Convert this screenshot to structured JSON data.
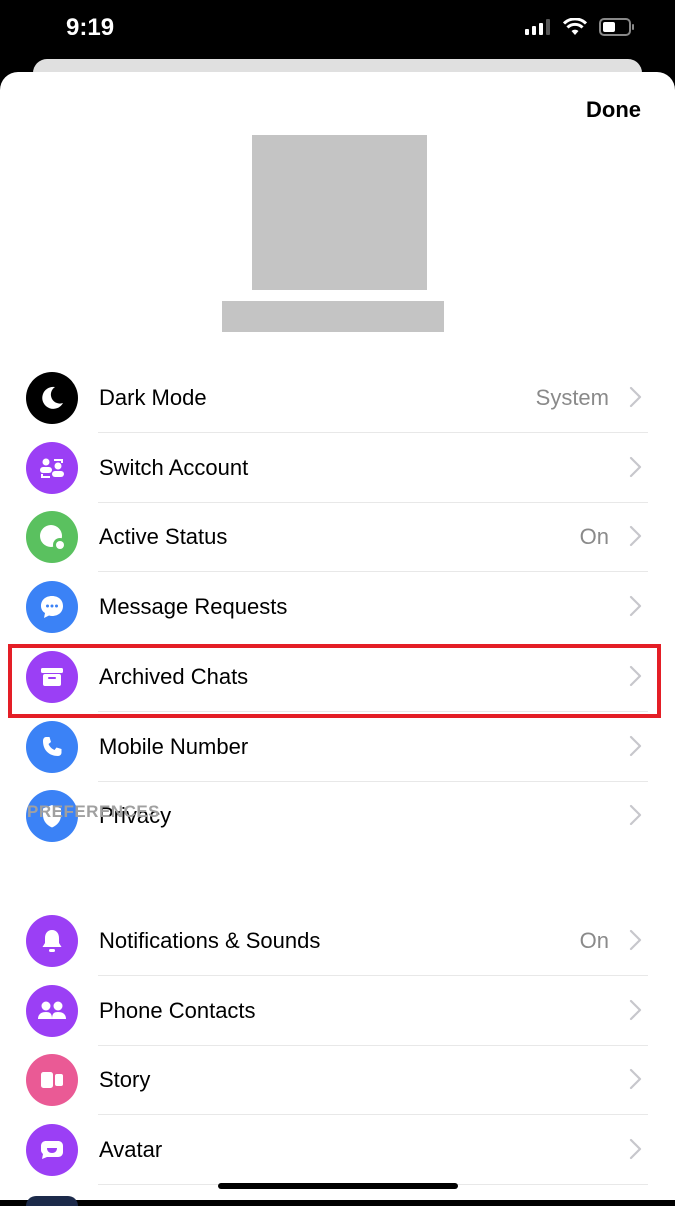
{
  "status_bar": {
    "time": "9:19",
    "icons": [
      "cellular-signal-icon",
      "wifi-icon",
      "battery-icon"
    ]
  },
  "header": {
    "done_label": "Done"
  },
  "profile": {
    "photo": "redacted-profile-photo",
    "name": "redacted-name"
  },
  "account_items": [
    {
      "label": "Dark Mode",
      "value": "System",
      "icon": "moon-icon",
      "color": "#000000"
    },
    {
      "label": "Switch Account",
      "value": "",
      "icon": "switch-account-icon",
      "color": "#9b3ff5"
    },
    {
      "label": "Active Status",
      "value": "On",
      "icon": "active-status-icon",
      "color": "#5ac15f"
    },
    {
      "label": "Message Requests",
      "value": "",
      "icon": "chat-bubble-icon",
      "color": "#3b82f6"
    },
    {
      "label": "Archived Chats",
      "value": "",
      "icon": "archive-box-icon",
      "color": "#9b3ff5"
    },
    {
      "label": "Mobile Number",
      "value": "",
      "icon": "phone-icon",
      "color": "#3b82f6"
    },
    {
      "label": "Privacy",
      "value": "",
      "icon": "shield-icon",
      "color": "#3b82f6"
    }
  ],
  "preferences": {
    "header": "PREFERENCES",
    "items": [
      {
        "label": "Notifications & Sounds",
        "value": "On",
        "icon": "bell-icon",
        "color": "#9b3ff5"
      },
      {
        "label": "Phone Contacts",
        "value": "",
        "icon": "contacts-icon",
        "color": "#9b3ff5"
      },
      {
        "label": "Story",
        "value": "",
        "icon": "story-icon",
        "color": "#ea5a95"
      },
      {
        "label": "Avatar",
        "value": "",
        "icon": "avatar-icon",
        "color": "#9b3ff5"
      }
    ]
  },
  "highlight": {
    "target": "Archived Chats",
    "color": "#e41e26"
  }
}
